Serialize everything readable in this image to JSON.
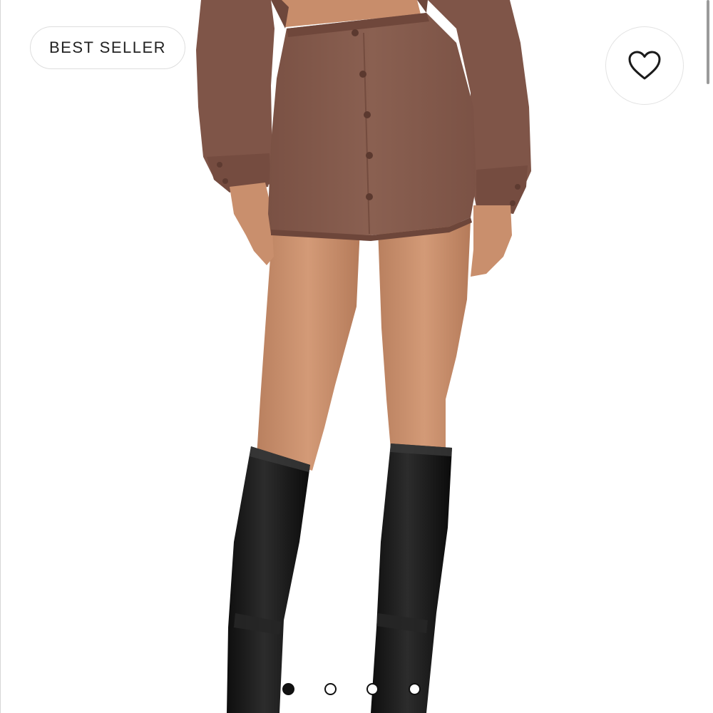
{
  "badge": {
    "label": "BEST SELLER"
  },
  "wishlist": {
    "icon": "heart-outline-icon"
  },
  "gallery": {
    "image": "product-photo-brown-button-front-mini-skirt",
    "slide_count": 4,
    "active_slide": 1
  },
  "colors": {
    "skirt": "#83594c",
    "sweatshirt": "#7f5548",
    "skin": "#c98f6d",
    "boots": "#151515"
  }
}
